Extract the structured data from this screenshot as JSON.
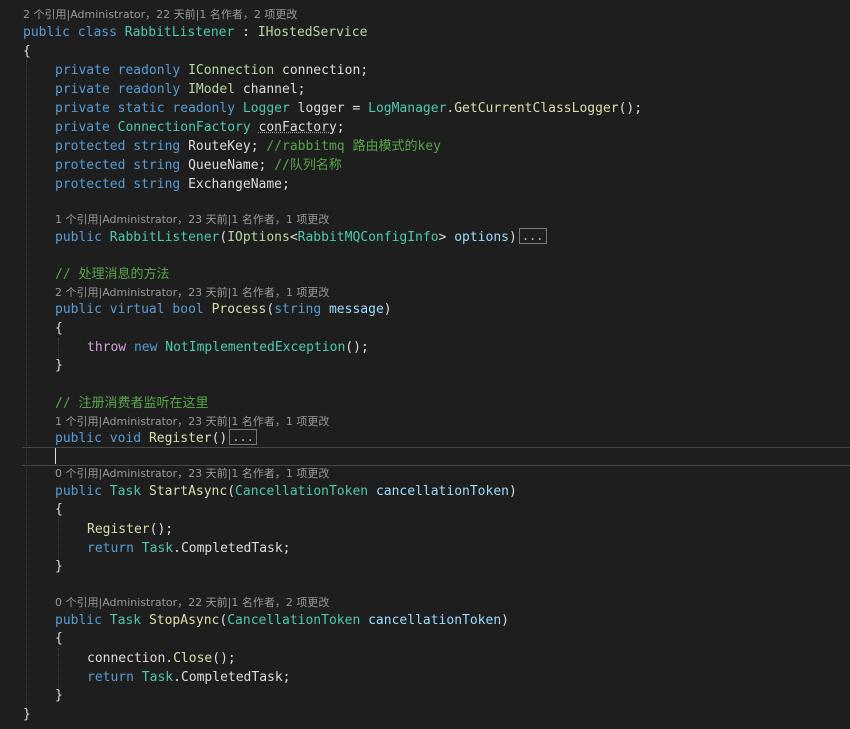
{
  "codelens": {
    "class": "2 个引用|Administrator，22 天前|1 名作者，2 项更改",
    "ctor": "1 个引用|Administrator，23 天前|1 名作者，1 项更改",
    "process": "2 个引用|Administrator，23 天前|1 名作者，1 项更改",
    "register": "1 个引用|Administrator，23 天前|1 名作者，1 项更改",
    "start": "0 个引用|Administrator，23 天前|1 名作者，1 项更改",
    "stop": "0 个引用|Administrator，22 天前|1 名作者，2 项更改"
  },
  "code": {
    "kw_public": "public",
    "kw_class": "class",
    "kw_private": "private",
    "kw_readonly": "readonly",
    "kw_static": "static",
    "kw_protected": "protected",
    "kw_string": "string",
    "kw_virtual": "virtual",
    "kw_bool": "bool",
    "kw_void": "void",
    "kw_new": "new",
    "kw_return": "return",
    "kw_throw": "throw",
    "class_name": "RabbitListener",
    "colon": " : ",
    "base_iface": "IHostedService",
    "brace_open": "{",
    "brace_close": "}",
    "i_connection": "IConnection",
    "f_connection": "connection;",
    "i_model": "IModel",
    "f_channel": "channel;",
    "t_logger": "Logger",
    "f_logger": "logger",
    "eq": " = ",
    "t_logmanager": "LogManager",
    "dot": ".",
    "m_getlogger": "GetCurrentClassLogger",
    "parens_semi": "();",
    "t_connfactory": "ConnectionFactory",
    "f_confactory": "conFactory",
    "semi": ";",
    "f_routekey": "RouteKey;",
    "cm_routekey": "//rabbitmq 路由模式的key",
    "f_queuename": "QueueName;",
    "cm_queuename": "//队列名称",
    "f_exchangename": "ExchangeName;",
    "ctor_name": "RabbitListener",
    "paren_open": "(",
    "i_options": "IOptions",
    "lt": "<",
    "t_config": "RabbitMQConfigInfo",
    "gt": ">",
    "p_options": "options",
    "paren_close": ")",
    "fold_marker": "...",
    "cm_process": "// 处理消息的方法",
    "m_process": "Process",
    "p_message": "message",
    "t_notimpl": "NotImplementedException",
    "cm_register": "// 注册消费者监听在这里",
    "m_register": "Register",
    "parens": "()",
    "t_task": "Task",
    "m_startasync": "StartAsync",
    "t_cancel": "CancellationToken",
    "p_cancel": "cancellationToken",
    "m_completed": "CompletedTask;",
    "m_stopasync": "StopAsync",
    "v_connection": "connection",
    "m_close": "Close"
  }
}
